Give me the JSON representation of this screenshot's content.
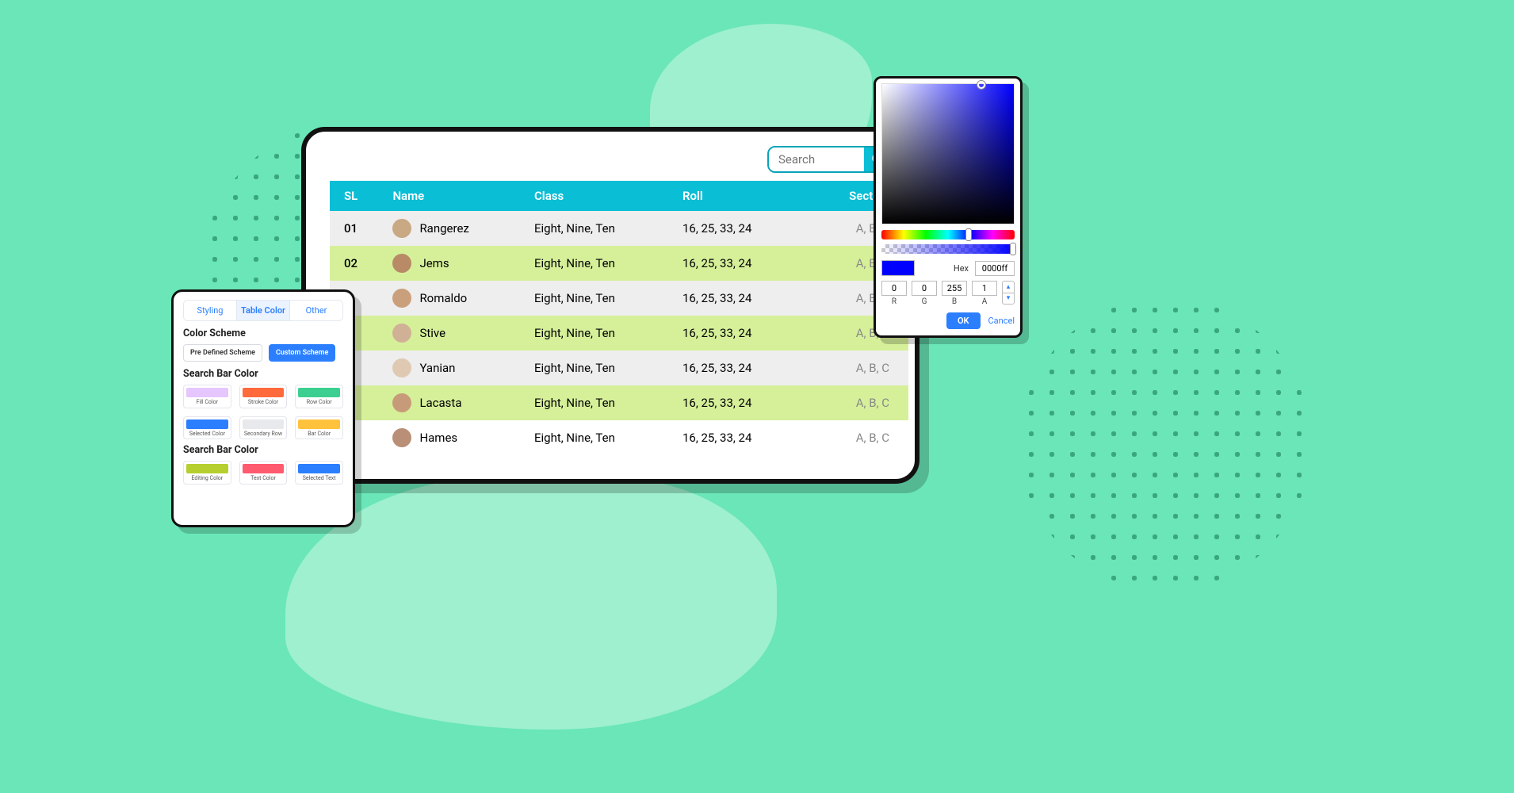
{
  "search": {
    "placeholder": "Search"
  },
  "table": {
    "headers": {
      "sl": "SL",
      "name": "Name",
      "class": "Class",
      "roll": "Roll",
      "section": "Section"
    },
    "rows": [
      {
        "sl": "01",
        "name": "Rangerez",
        "class": "Eight, Nine, Ten",
        "roll": "16, 25, 33, 24",
        "section": "A, B, C",
        "variant": "grey"
      },
      {
        "sl": "02",
        "name": "Jems",
        "class": "Eight, Nine, Ten",
        "roll": "16, 25, 33, 24",
        "section": "A, B, C",
        "variant": "green"
      },
      {
        "sl": "",
        "name": "Romaldo",
        "class": "Eight, Nine, Ten",
        "roll": "16, 25, 33, 24",
        "section": "A, B, C",
        "variant": "grey"
      },
      {
        "sl": "",
        "name": "Stive",
        "class": "Eight, Nine, Ten",
        "roll": "16, 25, 33, 24",
        "section": "A, B, C",
        "variant": "green"
      },
      {
        "sl": "",
        "name": "Yanian",
        "class": "Eight, Nine, Ten",
        "roll": "16, 25, 33, 24",
        "section": "A, B, C",
        "variant": "grey"
      },
      {
        "sl": "",
        "name": "Lacasta",
        "class": "Eight, Nine, Ten",
        "roll": "16, 25, 33, 24",
        "section": "A, B, C",
        "variant": "green"
      },
      {
        "sl": "",
        "name": "Hames",
        "class": "Eight, Nine, Ten",
        "roll": "16, 25, 33, 24",
        "section": "A, B, C",
        "variant": "white"
      }
    ]
  },
  "settings": {
    "tabs": {
      "styling": "Styling",
      "table_color": "Table Color",
      "other": "Other"
    },
    "section_color_scheme": "Color Scheme",
    "predef_btn": "Pre Defined Scheme",
    "custom_btn": "Custom Scheme",
    "section_search_bar_color_1": "Search Bar Color",
    "group1": [
      {
        "label": "Fill Color",
        "color": "#e5c6ff"
      },
      {
        "label": "Stroke Color",
        "color": "#ff6a3d"
      },
      {
        "label": "Row Color",
        "color": "#3ccf91"
      },
      {
        "label": "Selected Color",
        "color": "#2b7fff"
      },
      {
        "label": "Secondary Row",
        "color": "#e8e9ec"
      },
      {
        "label": "Bar Color",
        "color": "#ffc23d"
      }
    ],
    "section_search_bar_color_2": "Search Bar Color",
    "group2": [
      {
        "label": "Editing Color",
        "color": "#b6cf2e"
      },
      {
        "label": "Text Color",
        "color": "#ff5a6e"
      },
      {
        "label": "Selected Text",
        "color": "#2b7fff"
      }
    ]
  },
  "picker": {
    "hex_label": "Hex",
    "hex_value": "0000ff",
    "r": "0",
    "g": "0",
    "b": "255",
    "a": "1",
    "r_label": "R",
    "g_label": "G",
    "b_label": "B",
    "a_label": "A",
    "ok": "OK",
    "cancel": "Cancel",
    "swatch_color": "#0000ff"
  },
  "avatar_colors": [
    "#c9a884",
    "#b88a66",
    "#caa07c",
    "#d1b196",
    "#e0c9b2",
    "#c79b7a",
    "#b99077"
  ]
}
